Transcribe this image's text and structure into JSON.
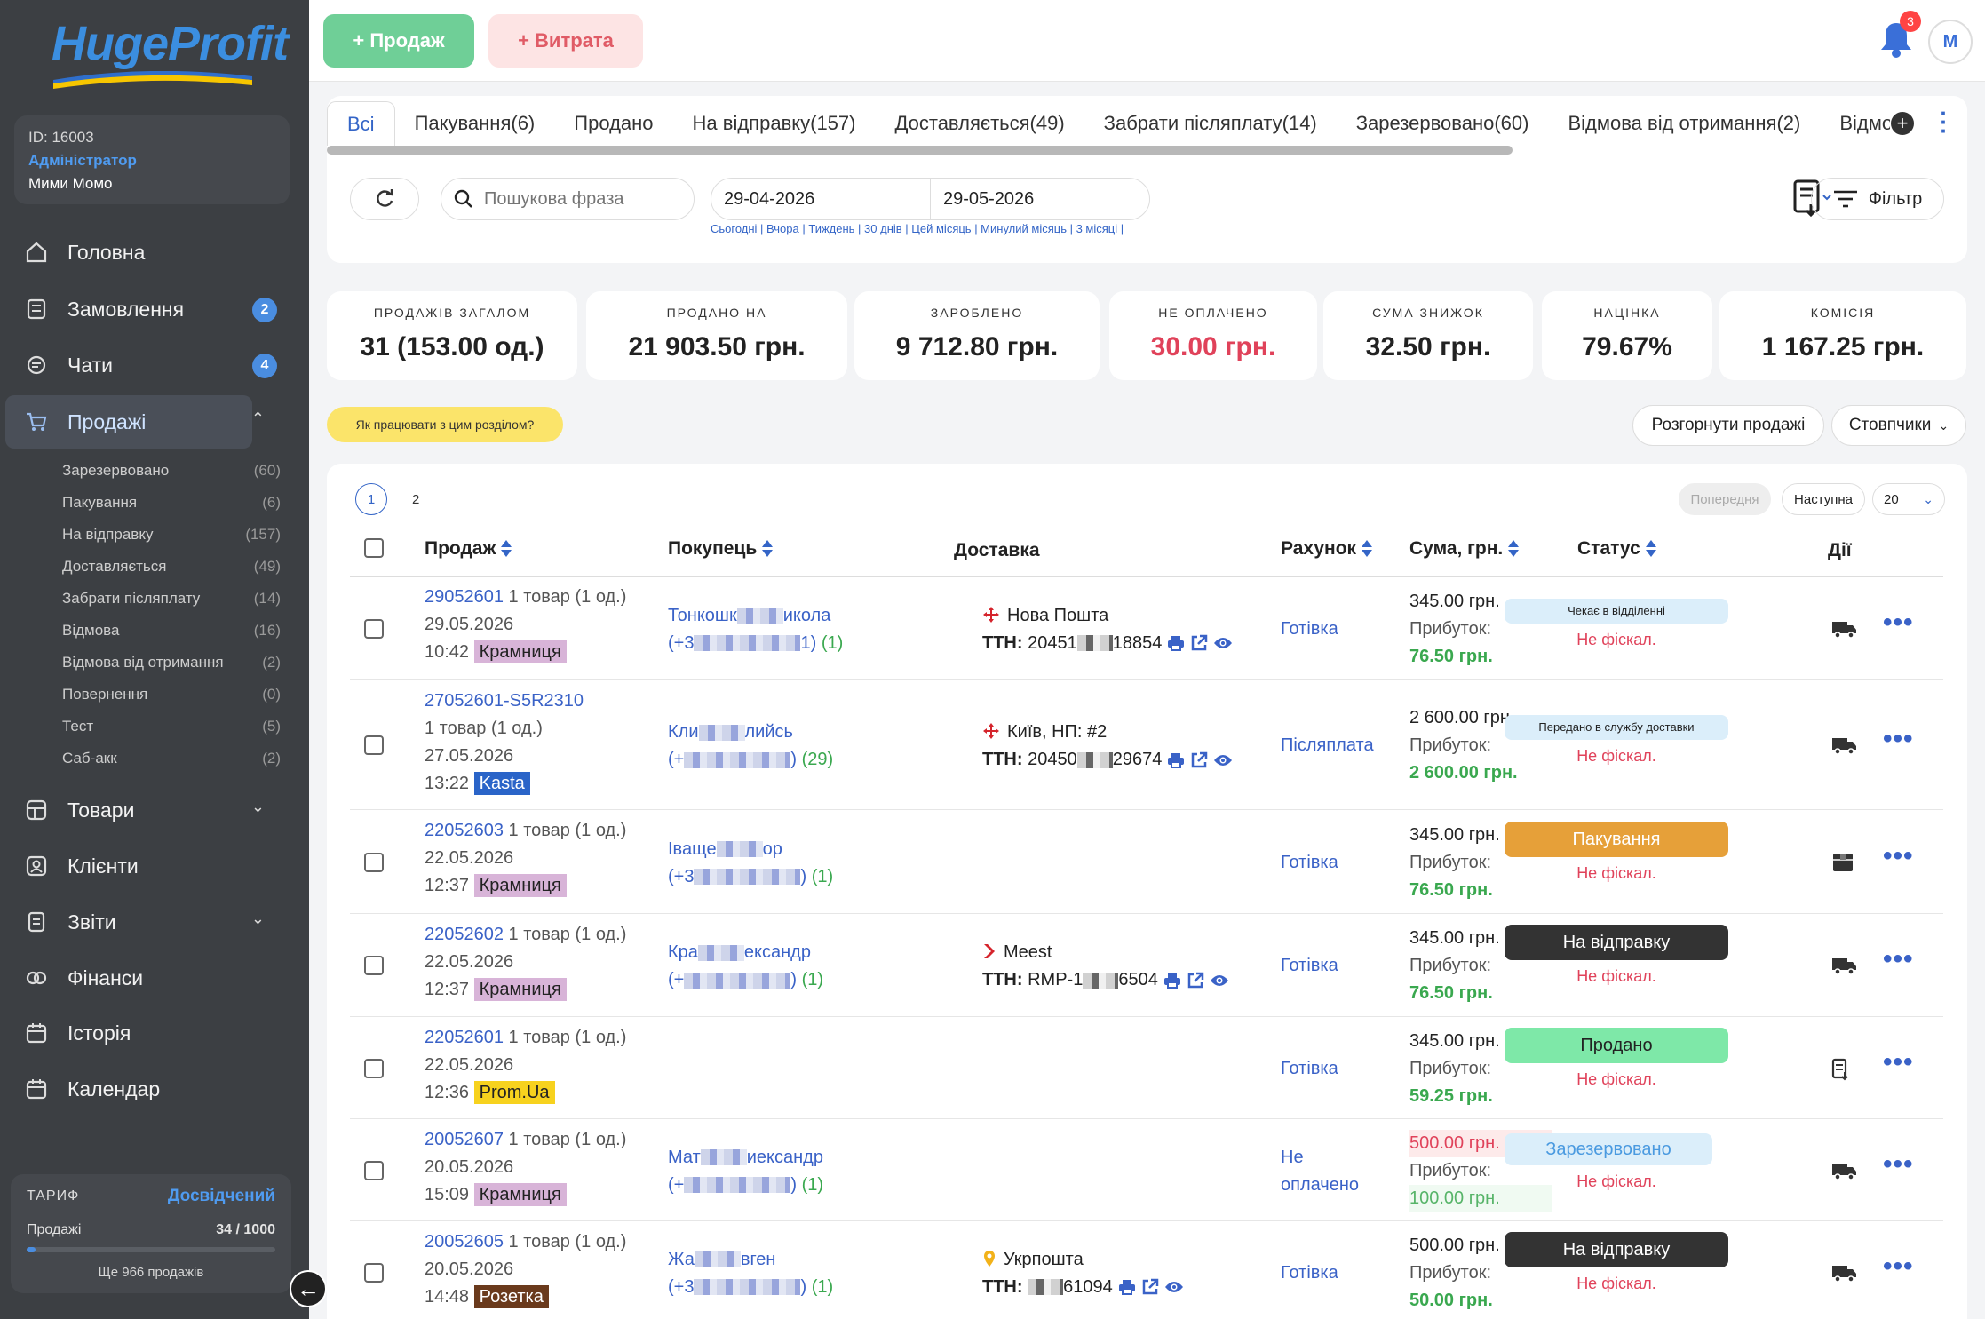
{
  "brand": {
    "logo": "HugeProfit"
  },
  "user": {
    "id": "ID: 16003",
    "role": "Адміністратор",
    "name": "Мими Момо"
  },
  "nav": [
    {
      "label": "Головна",
      "icon": "home-icon"
    },
    {
      "label": "Замовлення",
      "icon": "orders-icon",
      "badge": "2"
    },
    {
      "label": "Чати",
      "icon": "chat-icon",
      "badge": "4"
    },
    {
      "label": "Продажі",
      "icon": "cart-icon"
    },
    {
      "label": "Товари",
      "icon": "box-icon"
    },
    {
      "label": "Клієнти",
      "icon": "clients-icon"
    },
    {
      "label": "Звіти",
      "icon": "reports-icon"
    },
    {
      "label": "Фінанси",
      "icon": "finance-icon"
    },
    {
      "label": "Історія",
      "icon": "history-icon"
    },
    {
      "label": "Календар",
      "icon": "calendar-icon"
    }
  ],
  "sub_nav": [
    {
      "label": "Зарезервовано",
      "count": "(60)"
    },
    {
      "label": "Пакування",
      "count": "(6)"
    },
    {
      "label": "На відправку",
      "count": "(157)"
    },
    {
      "label": "Доставляється",
      "count": "(49)"
    },
    {
      "label": "Забрати післяплату",
      "count": "(14)"
    },
    {
      "label": "Відмова",
      "count": "(16)"
    },
    {
      "label": "Відмова від отримання",
      "count": "(2)"
    },
    {
      "label": "Повернення",
      "count": "(0)"
    },
    {
      "label": "Тест",
      "count": "(5)"
    },
    {
      "label": "Саб-акк",
      "count": "(2)"
    }
  ],
  "tariff": {
    "label": "ТАРИФ",
    "plan": "Досвідчений",
    "usage_label": "Продажі",
    "usage": "34 / 1000",
    "usage_fraction": 0.034,
    "remaining": "Ще 966 продажів"
  },
  "topbar": {
    "sale_label": "+ Продаж",
    "expense_label": "+ Витрата",
    "notifications": "3",
    "avatar": "M"
  },
  "tabs": [
    "Всі",
    "Пакування(6)",
    "Продано",
    "На відправку(157)",
    "Доставляється(49)",
    "Забрати післяплату(14)",
    "Зарезервовано(60)",
    "Відмова від отримання(2)",
    "Відмо"
  ],
  "filters": {
    "search_placeholder": "Пошукова фраза",
    "date_from": "29-04-2026",
    "date_to": "29-05-2026",
    "quick_ranges": "Сьогодні | Вчора | Тиждень | 30 днів | Цей місяць | Минулий місяць | 3 місяці |",
    "filter_label": "Фільтр"
  },
  "stats": [
    {
      "label": "ПРОДАЖІВ ЗАГАЛОМ",
      "value": "31 (153.00 од.)"
    },
    {
      "label": "ПРОДАНО НА",
      "value": "21 903.50 грн."
    },
    {
      "label": "ЗАРОБЛЕНО",
      "value": "9 712.80 грн."
    },
    {
      "label": "НЕ ОПЛАЧЕНО",
      "value": "30.00 грн."
    },
    {
      "label": "СУМА ЗНИЖОК",
      "value": "32.50 грн."
    },
    {
      "label": "НАЦІНКА",
      "value": "79.67%"
    },
    {
      "label": "КОМІСІЯ",
      "value": "1 167.25 грн."
    }
  ],
  "help_label": "Як працювати з цим розділом?",
  "expand_label": "Розгорнути продажі",
  "columns_label": "Стовпчики",
  "pagination": {
    "page1": "1",
    "page2": "2",
    "prev": "Попередня",
    "next": "Наступна",
    "per_page": "20"
  },
  "table": {
    "headers": [
      "Продаж",
      "Покупець",
      "Доставка",
      "Рахунок",
      "Сума, грн.",
      "Статус",
      "Дії"
    ],
    "profit_label": "Прибуток:",
    "ttn_label": "ТТН:",
    "rows": [
      {
        "id": "29052601",
        "items": "1 товар (1 од.)",
        "date": "29.05.2026",
        "time": "10:42",
        "channel": "Крамниця",
        "channel_style": "shop",
        "buyer_a": "Тонкошк",
        "buyer_b": "икола",
        "phone_a": "(+3",
        "phone_b": "1)",
        "orders": "(1)",
        "carrier": "Нова Пошта",
        "carrier_icon": "np",
        "ttn_a": "20451",
        "ttn_b": "18854",
        "account": "Готівка",
        "account2": "",
        "sum": "345.00 грн.",
        "profit": "76.50 грн.",
        "status": "Чекає в відділенні",
        "status_style": "light",
        "fiscal": "Не фіскал.",
        "action_icon": "truck-icon",
        "sum_red": false
      },
      {
        "id": "27052601-S5R2310",
        "items": "1 товар (1 од.)",
        "date": "27.05.2026",
        "time": "13:22",
        "channel": "Kasta",
        "channel_style": "kasta",
        "buyer_a": "Кли",
        "buyer_b": "лийсь",
        "phone_a": "(+",
        "phone_b": ")",
        "orders": "(29)",
        "carrier": "Київ, НП: #2",
        "carrier_icon": "np",
        "ttn_a": "20450",
        "ttn_b": "29674",
        "account": "Післяплата",
        "account2": "",
        "sum": "2 600.00 грн.",
        "profit": "2 600.00 грн.",
        "status": "Передано в службу доставки",
        "status_style": "light",
        "fiscal": "Не фіскал.",
        "action_icon": "truck-icon",
        "sum_red": false
      },
      {
        "id": "22052603",
        "items": "1 товар (1 од.)",
        "date": "22.05.2026",
        "time": "12:37",
        "channel": "Крамниця",
        "channel_style": "shop",
        "buyer_a": "Іващe",
        "buyer_b": "ор",
        "phone_a": "(+3",
        "phone_b": ")",
        "orders": "(1)",
        "carrier": "",
        "carrier_icon": "",
        "ttn_a": "",
        "ttn_b": "",
        "account": "Готівка",
        "account2": "",
        "sum": "345.00 грн.",
        "profit": "76.50 грн.",
        "status": "Пакування",
        "status_style": "orange",
        "fiscal": "Не фіскал.",
        "action_icon": "box-icon",
        "sum_red": false
      },
      {
        "id": "22052602",
        "items": "1 товар (1 од.)",
        "date": "22.05.2026",
        "time": "12:37",
        "channel": "Крамниця",
        "channel_style": "shop",
        "buyer_a": "Кра",
        "buyer_b": "ександр",
        "phone_a": "(+",
        "phone_b": ")",
        "orders": "(1)",
        "carrier": "Meest",
        "carrier_icon": "meest",
        "ttn_a": "RMP-1",
        "ttn_b": "6504",
        "account": "Готівка",
        "account2": "",
        "sum": "345.00 грн.",
        "profit": "76.50 грн.",
        "status": "На відправку",
        "status_style": "dark",
        "fiscal": "Не фіскал.",
        "action_icon": "truck-icon",
        "sum_red": false
      },
      {
        "id": "22052601",
        "items": "1 товар (1 од.)",
        "date": "22.05.2026",
        "time": "12:36",
        "channel": "Prom.Ua",
        "channel_style": "prom",
        "buyer_a": "",
        "buyer_b": "",
        "phone_a": "",
        "phone_b": "",
        "orders": "",
        "carrier": "",
        "carrier_icon": "",
        "ttn_a": "",
        "ttn_b": "",
        "account": "Готівка",
        "account2": "",
        "sum": "345.00 грн.",
        "profit": "59.25 грн.",
        "status": "Продано",
        "status_style": "green",
        "fiscal": "Не фіскал.",
        "action_icon": "receipt-icon",
        "sum_red": false
      },
      {
        "id": "20052607",
        "items": "1 товар (1 од.)",
        "date": "20.05.2026",
        "time": "15:09",
        "channel": "Крамниця",
        "channel_style": "shop",
        "buyer_a": "Мат",
        "buyer_b": "иександр",
        "phone_a": "(+",
        "phone_b": ")",
        "orders": "(1)",
        "carrier": "",
        "carrier_icon": "",
        "ttn_a": "",
        "ttn_b": "",
        "account": "Не",
        "account2": "оплачено",
        "sum": "500.00 грн.",
        "profit": "100.00 грн.",
        "status": "Зарезервовано",
        "status_style": "res",
        "fiscal": "Не фіскал.",
        "action_icon": "truck-icon",
        "sum_red": true
      },
      {
        "id": "20052605",
        "items": "1 товар (1 од.)",
        "date": "20.05.2026",
        "time": "14:48",
        "channel": "Розетка",
        "channel_style": "roz",
        "buyer_a": "Жа",
        "buyer_b": "вген",
        "phone_a": "(+3",
        "phone_b": ")",
        "orders": "(1)",
        "carrier": "Укрпошта",
        "carrier_icon": "ukr",
        "ttn_a": "",
        "ttn_b": "61094",
        "account": "Готівка",
        "account2": "",
        "sum": "500.00 грн.",
        "profit": "50.00 грн.",
        "status": "На відправку",
        "status_style": "dark",
        "fiscal": "Не фіскал.",
        "action_icon": "truck-icon",
        "sum_red": false
      }
    ]
  }
}
